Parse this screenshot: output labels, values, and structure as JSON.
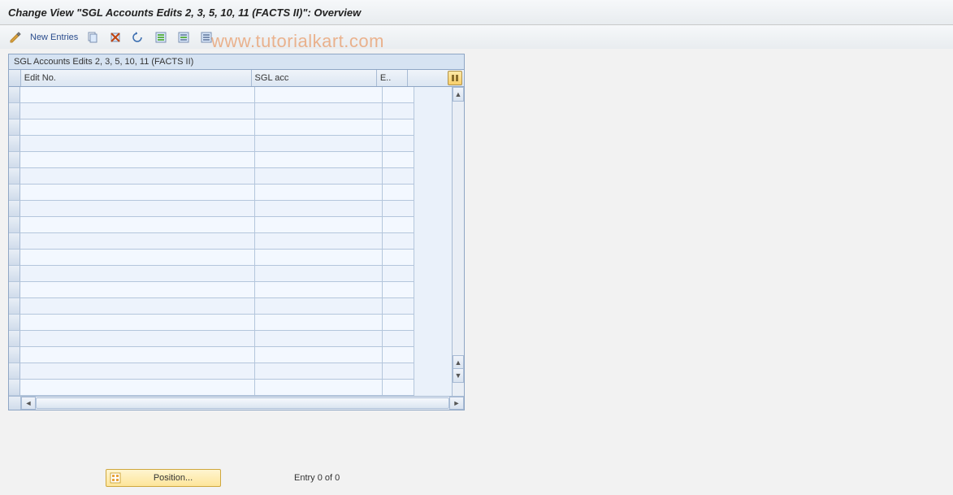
{
  "title": "Change View \"SGL Accounts Edits 2, 3, 5, 10, 11  (FACTS II)\": Overview",
  "watermark": "www.tutorialkart.com",
  "toolbar": {
    "new_entries_label": "New Entries"
  },
  "grid": {
    "title": "SGL Accounts Edits 2, 3, 5, 10, 11  (FACTS II)",
    "columns": {
      "c1": "Edit No.",
      "c2": "SGL acc",
      "c3": "E.."
    },
    "row_count": 19,
    "rows": [
      {
        "c1": "",
        "c2": "",
        "c3": ""
      },
      {
        "c1": "",
        "c2": "",
        "c3": ""
      },
      {
        "c1": "",
        "c2": "",
        "c3": ""
      },
      {
        "c1": "",
        "c2": "",
        "c3": ""
      },
      {
        "c1": "",
        "c2": "",
        "c3": ""
      },
      {
        "c1": "",
        "c2": "",
        "c3": ""
      },
      {
        "c1": "",
        "c2": "",
        "c3": ""
      },
      {
        "c1": "",
        "c2": "",
        "c3": ""
      },
      {
        "c1": "",
        "c2": "",
        "c3": ""
      },
      {
        "c1": "",
        "c2": "",
        "c3": ""
      },
      {
        "c1": "",
        "c2": "",
        "c3": ""
      },
      {
        "c1": "",
        "c2": "",
        "c3": ""
      },
      {
        "c1": "",
        "c2": "",
        "c3": ""
      },
      {
        "c1": "",
        "c2": "",
        "c3": ""
      },
      {
        "c1": "",
        "c2": "",
        "c3": ""
      },
      {
        "c1": "",
        "c2": "",
        "c3": ""
      },
      {
        "c1": "",
        "c2": "",
        "c3": ""
      },
      {
        "c1": "",
        "c2": "",
        "c3": ""
      },
      {
        "c1": "",
        "c2": "",
        "c3": ""
      }
    ]
  },
  "footer": {
    "position_label": "Position...",
    "entry_info": "Entry 0 of 0"
  }
}
